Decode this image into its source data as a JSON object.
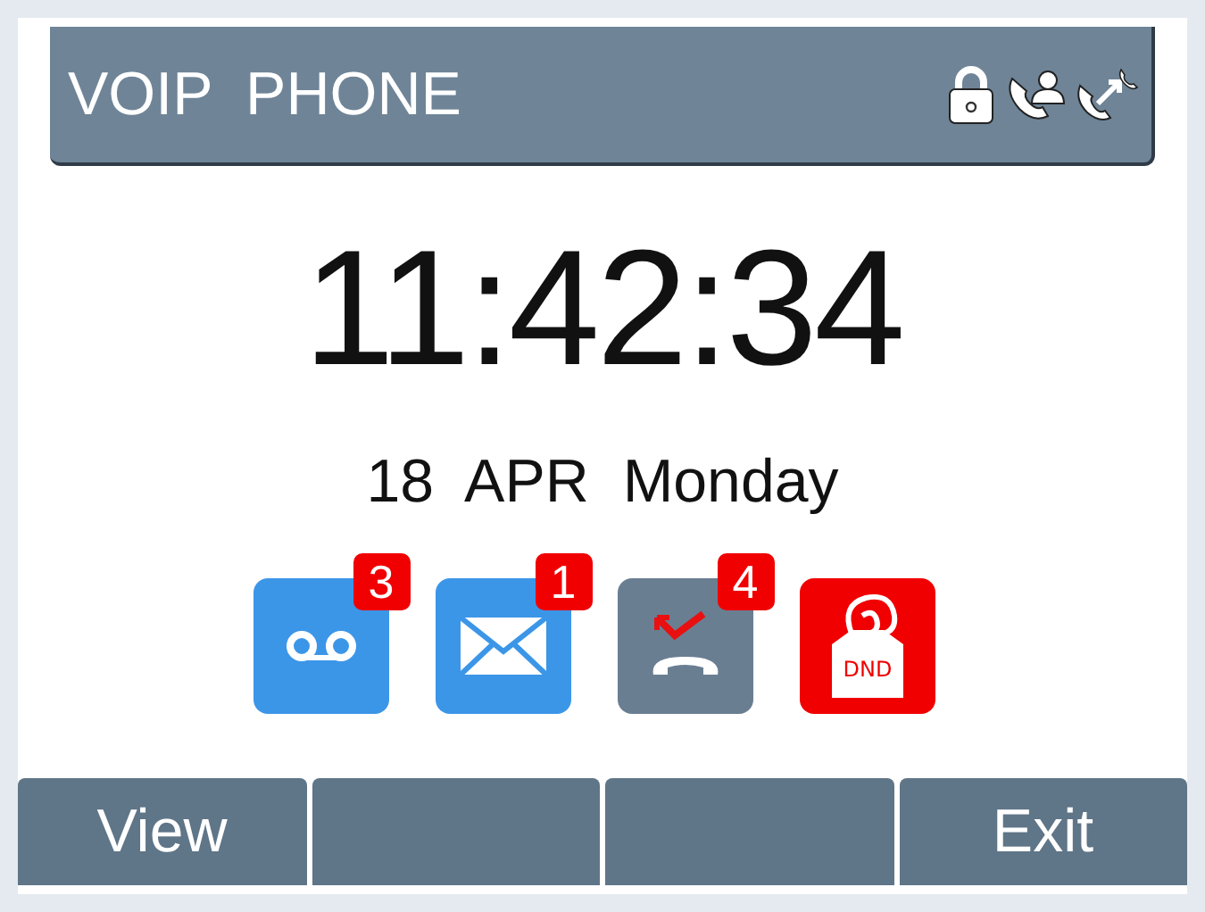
{
  "title_bar": {
    "title": "VOIP  PHONE",
    "icons": [
      {
        "kind": "lock"
      },
      {
        "kind": "contact-call"
      },
      {
        "kind": "forward"
      }
    ]
  },
  "clock": {
    "time": "11:42:34",
    "date": "18  APR  Monday"
  },
  "notifications": [
    {
      "kind": "voicemail",
      "color": "#3c96e8",
      "count": "3"
    },
    {
      "kind": "message",
      "color": "#3c96e8",
      "count": "1"
    },
    {
      "kind": "missed-call",
      "color": "#6a7e92",
      "count": "4"
    },
    {
      "kind": "dnd",
      "color": "#f00000",
      "label": "DND"
    }
  ],
  "softkeys": [
    {
      "kind": "labeled",
      "label": "View"
    },
    {
      "kind": "blank"
    },
    {
      "kind": "blank"
    },
    {
      "kind": "labeled",
      "label": "Exit"
    }
  ]
}
